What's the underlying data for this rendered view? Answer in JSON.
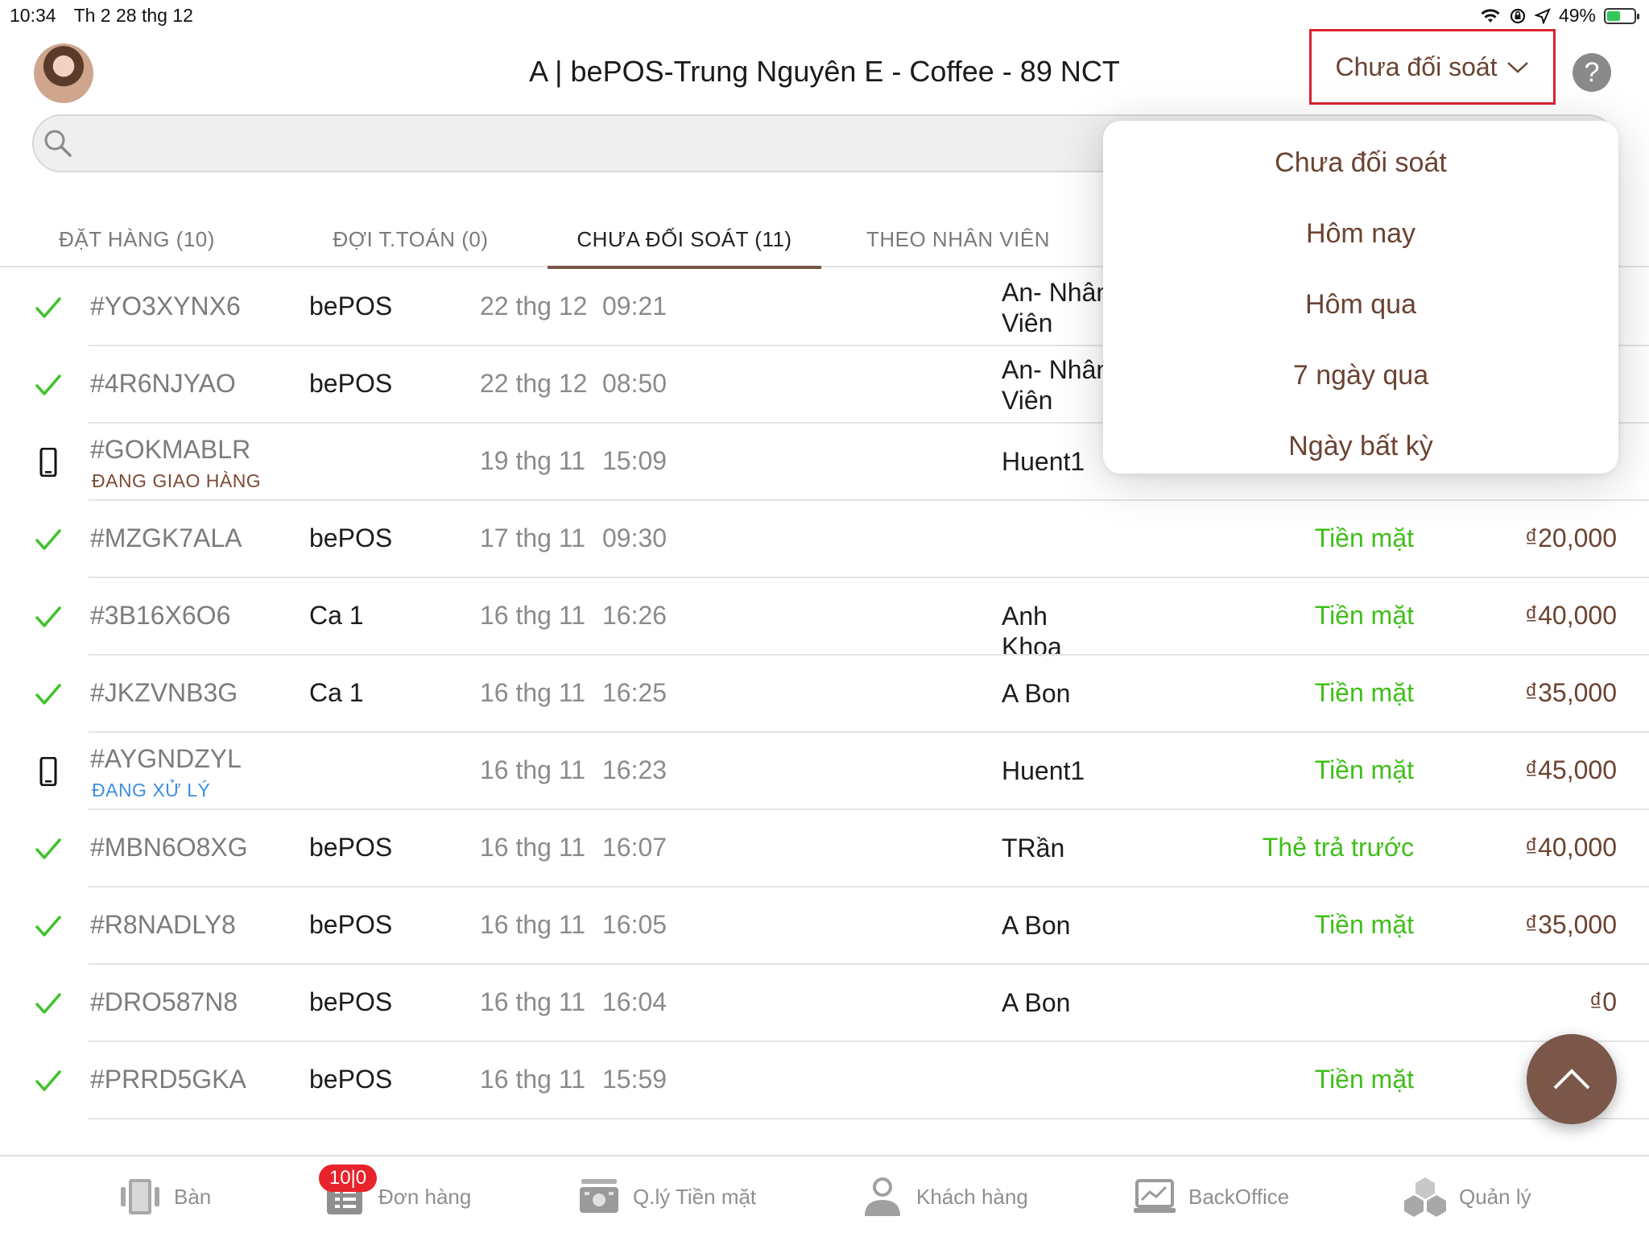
{
  "status_bar": {
    "time": "10:34",
    "date": "Th 2 28 thg 12",
    "battery": "49%",
    "battery_level": 0.49
  },
  "header": {
    "title": "A | bePOS-Trung Nguyên E - Coffee - 89 NCT",
    "filter_label": "Chưa đối soát",
    "help_label": "?"
  },
  "search": {
    "placeholder": ""
  },
  "tabs": [
    {
      "label": "ĐẶT HÀNG (10)"
    },
    {
      "label": "ĐỢI T.TOÁN (0)"
    },
    {
      "label": "CHƯA ĐỐI SOÁT (11)"
    },
    {
      "label": "THEO NHÂN VIÊN"
    }
  ],
  "active_tab": 2,
  "orders": [
    {
      "code": "#YO3XYNX6",
      "status": "",
      "source": "bePOS",
      "date": "22 thg 12",
      "time": "09:21",
      "staff": "An- Nhân Viên",
      "payment": "",
      "amount": "",
      "icon": "check-icon"
    },
    {
      "code": "#4R6NJYAO",
      "status": "",
      "source": "bePOS",
      "date": "22 thg 12",
      "time": "08:50",
      "staff": "An- Nhân Viên",
      "payment": "",
      "amount": "",
      "icon": "check-icon"
    },
    {
      "code": "#GOKMABLR",
      "status": "ĐANG GIAO HÀNG",
      "status_color": "#7b4a36",
      "source": "",
      "date": "19 thg 11",
      "time": "15:09",
      "staff": "Huent1",
      "payment": "",
      "amount": "",
      "icon": "phone-icon"
    },
    {
      "code": "#MZGK7ALA",
      "status": "",
      "source": "bePOS",
      "date": "17 thg 11",
      "time": "09:30",
      "staff": "",
      "payment": "Tiền mặt",
      "amount": "₫20,000",
      "icon": "check-icon"
    },
    {
      "code": "#3B16X6O6",
      "status": "",
      "source": "Ca 1",
      "date": "16 thg 11",
      "time": "16:26",
      "staff": "Anh Khoa",
      "payment": "Tiền mặt",
      "amount": "₫40,000",
      "icon": "check-icon"
    },
    {
      "code": "#JKZVNB3G",
      "status": "",
      "source": "Ca 1",
      "date": "16 thg 11",
      "time": "16:25",
      "staff": "A Bon",
      "payment": "Tiền mặt",
      "amount": "₫35,000",
      "icon": "check-icon"
    },
    {
      "code": "#AYGNDZYL",
      "status": "ĐANG XỬ LÝ",
      "status_color": "#3d8fe0",
      "source": "",
      "date": "16 thg 11",
      "time": "16:23",
      "staff": "Huent1",
      "payment": "Tiền mặt",
      "amount": "₫45,000",
      "icon": "phone-icon"
    },
    {
      "code": "#MBN6O8XG",
      "status": "",
      "source": "bePOS",
      "date": "16 thg 11",
      "time": "16:07",
      "staff": "TRần",
      "payment": "Thẻ trả trước",
      "amount": "₫40,000",
      "icon": "check-icon"
    },
    {
      "code": "#R8NADLY8",
      "status": "",
      "source": "bePOS",
      "date": "16 thg 11",
      "time": "16:05",
      "staff": "A Bon",
      "payment": "Tiền mặt",
      "amount": "₫35,000",
      "icon": "check-icon"
    },
    {
      "code": "#DRO587N8",
      "status": "",
      "source": "bePOS",
      "date": "16 thg 11",
      "time": "16:04",
      "staff": "A Bon",
      "payment": "",
      "amount": "₫0",
      "icon": "check-icon"
    },
    {
      "code": "#PRRD5GKA",
      "status": "",
      "source": "bePOS",
      "date": "16 thg 11",
      "time": "15:59",
      "staff": "",
      "payment": "Tiền mặt",
      "amount": "",
      "icon": "check-icon"
    }
  ],
  "filter_menu": {
    "items": [
      {
        "label": "Chưa đối soát"
      },
      {
        "label": "Hôm nay"
      },
      {
        "label": "Hôm qua"
      },
      {
        "label": "7 ngày qua"
      },
      {
        "label": "Ngày bất kỳ"
      }
    ]
  },
  "bottom_nav": {
    "items": [
      {
        "label": "Bàn",
        "icon": "table-icon"
      },
      {
        "label": "Đơn hàng",
        "icon": "orders-icon"
      },
      {
        "label": "Q.lý Tiền mặt",
        "icon": "cash-register-icon"
      },
      {
        "label": "Khách hàng",
        "icon": "customer-icon"
      },
      {
        "label": "BackOffice",
        "icon": "backoffice-icon"
      },
      {
        "label": "Quản lý",
        "icon": "management-icon"
      }
    ],
    "orders_badge": "10|0"
  },
  "colors": {
    "brand_brown": "#6b4332",
    "tab_underline": "#7b5748",
    "payment_green": "#3fbf19",
    "check_green": "#3ec22a",
    "highlight_red": "#d8242f",
    "badge_red": "#e8232b"
  }
}
